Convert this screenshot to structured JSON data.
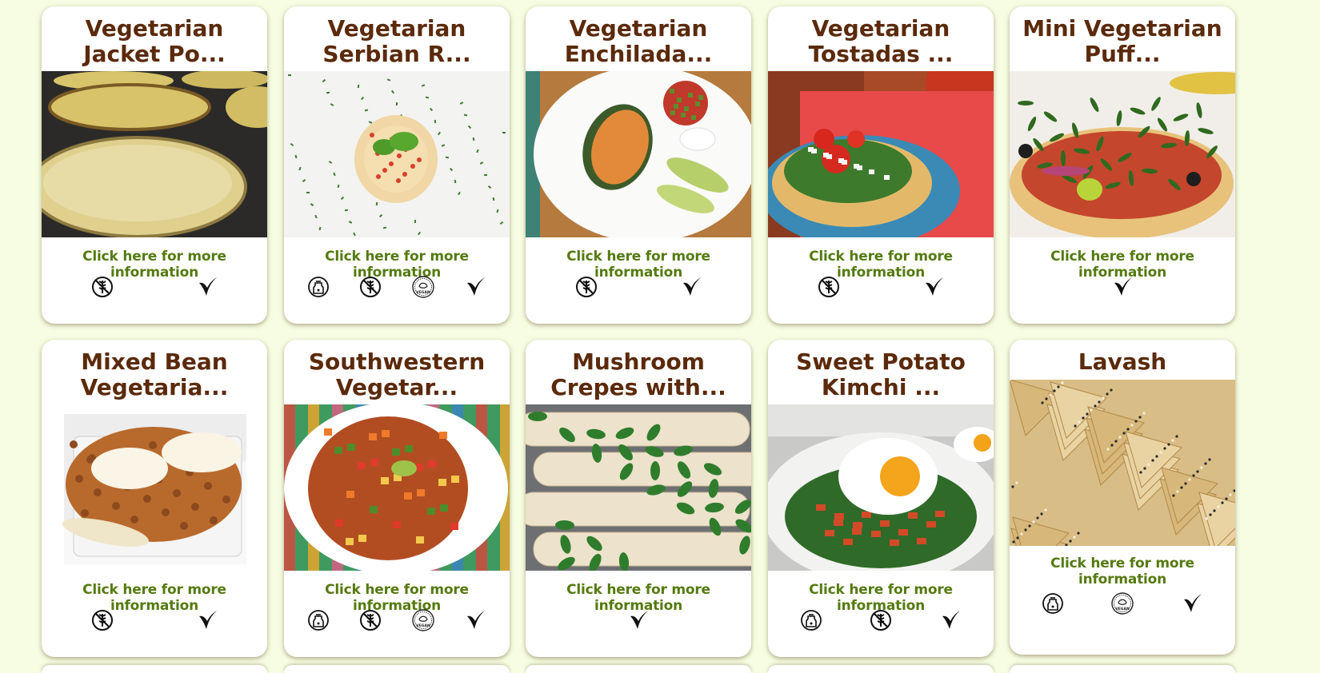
{
  "info_label": "Click here for more information",
  "cards": [
    {
      "title": "Vegetarian Jacket Po...",
      "icons": [
        "gluten-free-icon",
        "vegetarian-icon"
      ],
      "photo": "baked-potatoes"
    },
    {
      "title": "Vegetarian Serbian R...",
      "icons": [
        "dairy-free-icon",
        "gluten-free-icon",
        "vegan-icon",
        "vegetarian-icon"
      ],
      "photo": "rice-timbale"
    },
    {
      "title": "Vegetarian Enchilada...",
      "icons": [
        "gluten-free-icon",
        "vegetarian-icon"
      ],
      "photo": "stuffed-pepper"
    },
    {
      "title": "Vegetarian Tostadas ...",
      "icons": [
        "gluten-free-icon",
        "vegetarian-icon"
      ],
      "photo": "tostada"
    },
    {
      "title": "Mini Vegetarian Puff...",
      "icons": [
        "vegetarian-icon"
      ],
      "photo": "puff-pizza"
    },
    {
      "title": "Mixed Bean Vegetaria...",
      "icons": [
        "gluten-free-icon",
        "vegetarian-icon"
      ],
      "photo": "bean-bake"
    },
    {
      "title": "Southwestern Vegetar...",
      "icons": [
        "dairy-free-icon",
        "gluten-free-icon",
        "vegan-icon",
        "vegetarian-icon"
      ],
      "photo": "veg-soup"
    },
    {
      "title": "Mushroom Crepes with...",
      "icons": [
        "vegetarian-icon"
      ],
      "photo": "crepes"
    },
    {
      "title": "Sweet Potato Kimchi ...",
      "icons": [
        "dairy-free-icon",
        "gluten-free-icon",
        "vegetarian-icon"
      ],
      "photo": "egg-kimchi"
    },
    {
      "title": "Lavash",
      "icons": [
        "dairy-free-icon",
        "vegan-icon",
        "vegetarian-icon"
      ],
      "photo": "lavash"
    }
  ]
}
